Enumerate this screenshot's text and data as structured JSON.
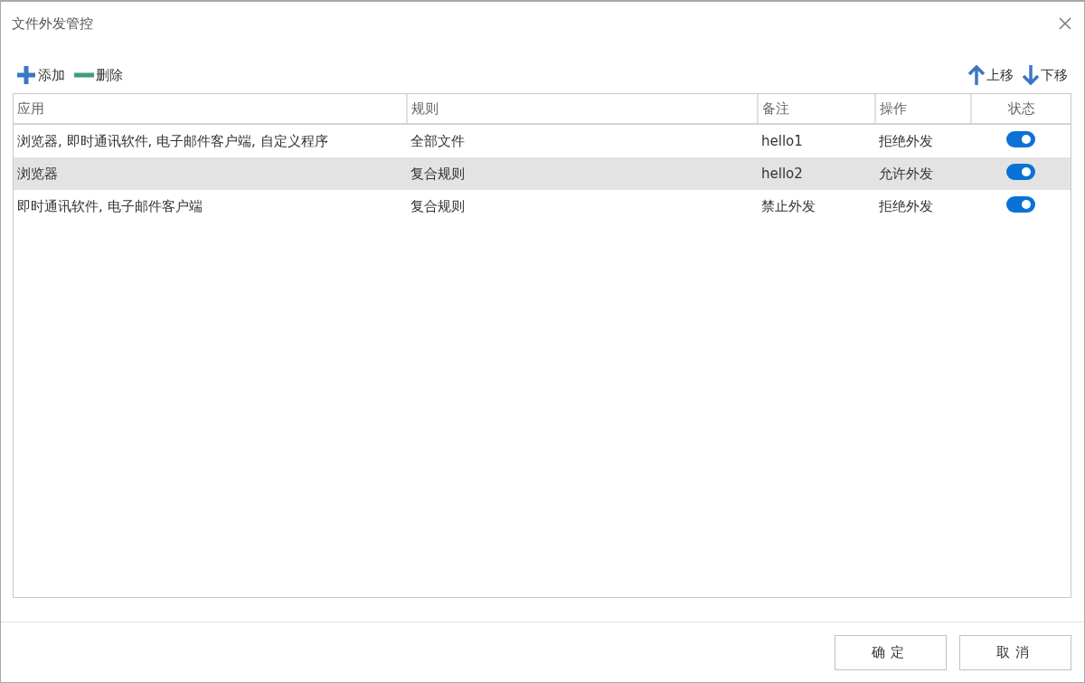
{
  "window": {
    "title": "文件外发管控"
  },
  "toolbar": {
    "left": [
      {
        "kind": "add",
        "label": "添加"
      },
      {
        "kind": "remove",
        "label": "删除"
      }
    ],
    "right": [
      {
        "kind": "up",
        "label": "上移"
      },
      {
        "kind": "down",
        "label": "下移"
      }
    ]
  },
  "table": {
    "columns": [
      "应用",
      "规则",
      "备注",
      "操作",
      "状态"
    ],
    "rows": [
      {
        "app": "浏览器, 即时通讯软件, 电子邮件客户端, 自定义程序",
        "rule": "全部文件",
        "note": "hello1",
        "action": "拒绝外发",
        "enabled": true,
        "selected": false
      },
      {
        "app": "浏览器",
        "rule": "复合规则",
        "note": "hello2",
        "action": "允许外发",
        "enabled": true,
        "selected": true
      },
      {
        "app": "即时通讯软件, 电子邮件客户端",
        "rule": "复合规则",
        "note": "禁止外发",
        "action": "拒绝外发",
        "enabled": true,
        "selected": false
      }
    ]
  },
  "buttons": [
    "确定",
    "取消"
  ]
}
